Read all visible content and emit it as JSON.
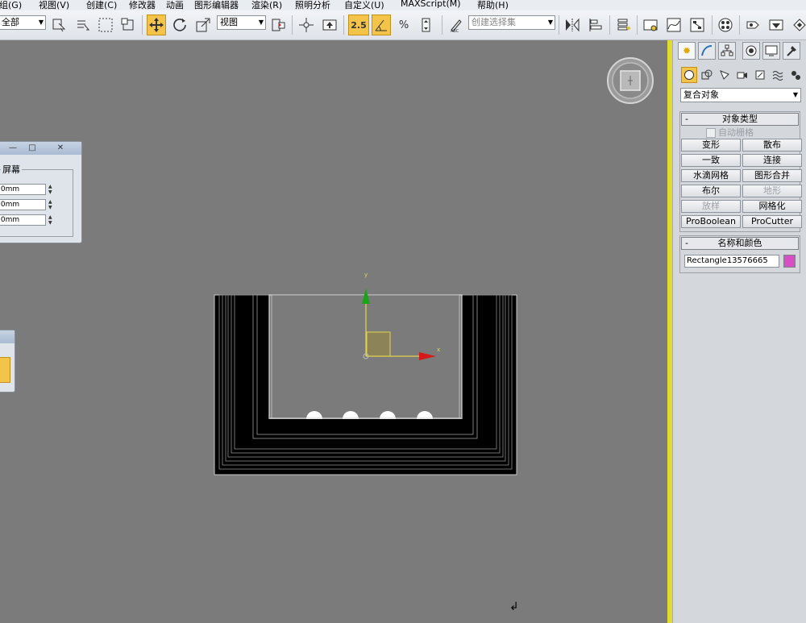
{
  "menubar": {
    "items": [
      "组(G)",
      "视图(V)",
      "创建(C)",
      "修改器",
      "动画",
      "图形编辑器",
      "渲染(R)",
      "照明分析",
      "自定义(U)",
      "MAXScript(M)",
      "帮助(H)"
    ]
  },
  "toolbar": {
    "selection_filter": "全部",
    "reference_coord": "视图",
    "snap_value": "2.5",
    "named_selection_placeholder": "创建选择集"
  },
  "viewport": {
    "gizmo_x_label": "x",
    "gizmo_y_label": "y"
  },
  "float_window": {
    "group_title": "屏幕",
    "values": [
      ".0mm",
      ".0mm",
      ".0mm"
    ]
  },
  "command_panel": {
    "category_dropdown": "复合对象",
    "object_type": {
      "title": "对象类型",
      "minus": "-",
      "autogrid_label": "自动栅格",
      "buttons": [
        {
          "label": "变形",
          "enabled": true
        },
        {
          "label": "散布",
          "enabled": true
        },
        {
          "label": "一致",
          "enabled": true
        },
        {
          "label": "连接",
          "enabled": true
        },
        {
          "label": "水滴网格",
          "enabled": true
        },
        {
          "label": "图形合并",
          "enabled": true
        },
        {
          "label": "布尔",
          "enabled": true
        },
        {
          "label": "地形",
          "enabled": false
        },
        {
          "label": "放样",
          "enabled": false
        },
        {
          "label": "网格化",
          "enabled": true
        },
        {
          "label": "ProBoolean",
          "enabled": true
        },
        {
          "label": "ProCutter",
          "enabled": true
        }
      ]
    },
    "name_color": {
      "title": "名称和颜色",
      "minus": "-",
      "object_name": "Rectangle13576665",
      "color": "#d84fc4"
    }
  },
  "colors": {
    "viewport_bg": "#7b7b7b",
    "active_highlight": "#f3c34a",
    "viewport_active_border": "#e2dd2a"
  }
}
